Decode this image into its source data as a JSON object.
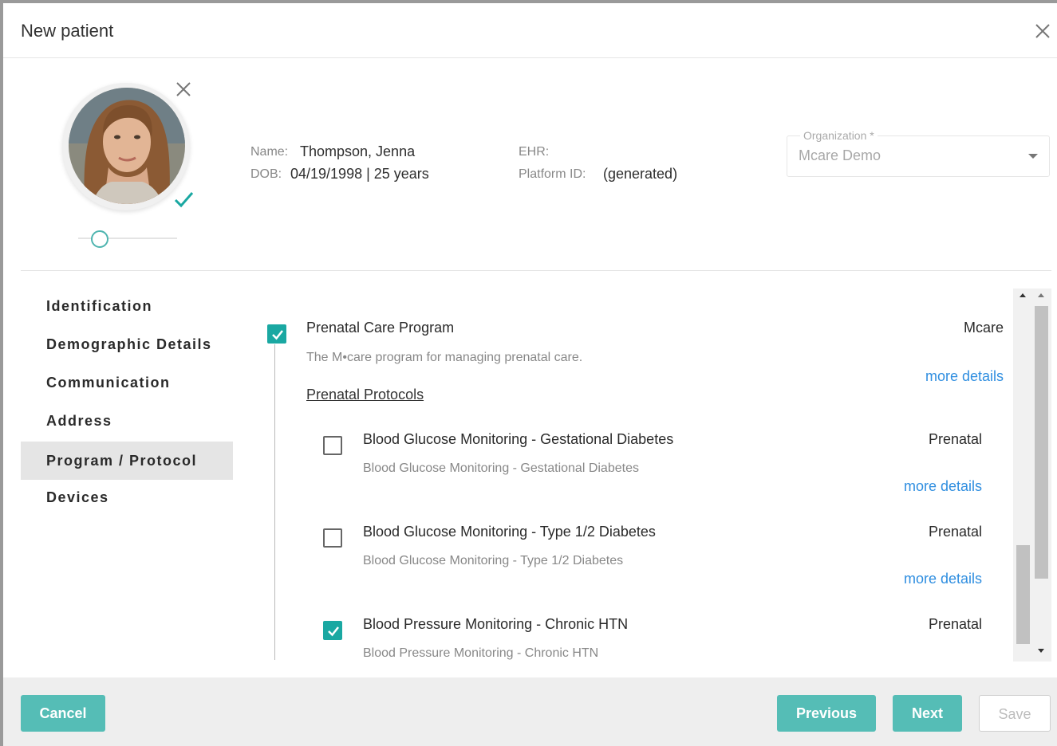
{
  "dialog": {
    "title": "New patient"
  },
  "patient": {
    "name_label": "Name:",
    "name": "Thompson, Jenna",
    "dob_label": "DOB:",
    "dob": "04/19/1998 | 25 years",
    "ehr_label": "EHR:",
    "ehr": "",
    "platform_label": "Platform ID:",
    "platform": "(generated)"
  },
  "organization": {
    "label": "Organization *",
    "value": "Mcare Demo"
  },
  "photo": {
    "zoom_level": 0.25
  },
  "nav": {
    "items": [
      {
        "label": "Identification"
      },
      {
        "label": "Demographic Details"
      },
      {
        "label": "Communication"
      },
      {
        "label": "Address"
      },
      {
        "label": "Program / Protocol",
        "active": true
      },
      {
        "label": "Devices"
      }
    ]
  },
  "program": {
    "title": "Prenatal Care Program",
    "org": "Mcare",
    "description": "The M•care program for managing prenatal care.",
    "more": "more details",
    "protocols_header": "Prenatal Protocols",
    "checked": true
  },
  "protocols": [
    {
      "title": "Blood Glucose Monitoring - Gestational Diabetes",
      "desc": "Blood Glucose Monitoring - Gestational Diabetes",
      "tag": "Prenatal",
      "more": "more details",
      "checked": false
    },
    {
      "title": "Blood Glucose Monitoring - Type 1/2 Diabetes",
      "desc": "Blood Glucose Monitoring - Type 1/2 Diabetes",
      "tag": "Prenatal",
      "more": "more details",
      "checked": false
    },
    {
      "title": "Blood Pressure Monitoring - Chronic HTN",
      "desc": "Blood Pressure Monitoring - Chronic HTN",
      "tag": "Prenatal",
      "checked": true
    }
  ],
  "footer": {
    "cancel": "Cancel",
    "previous": "Previous",
    "next": "Next",
    "save": "Save"
  },
  "colors": {
    "accent": "#55bdb6",
    "checkbox": "#1aa8a2",
    "link": "#2f8ee0"
  }
}
